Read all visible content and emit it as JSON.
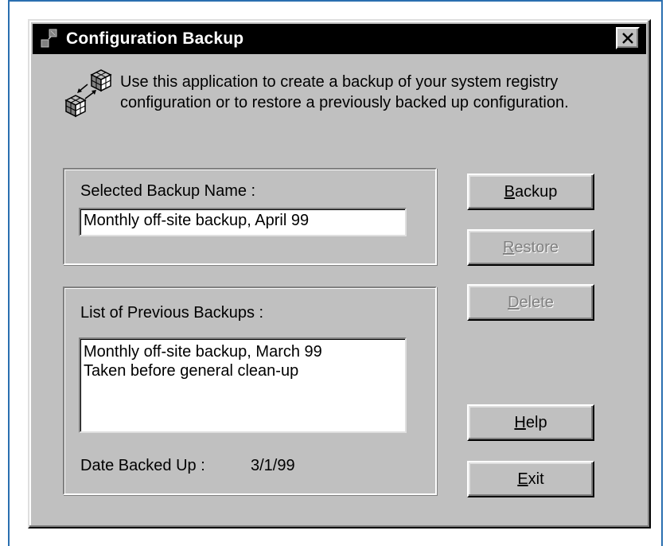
{
  "window": {
    "title": "Configuration Backup",
    "close_symbol": "✕"
  },
  "intro": {
    "line1": "Use this application to create a backup of your system registry",
    "line2": "configuration or to restore a previously backed up configuration.",
    "icon": "backup-cubes-icon"
  },
  "selected_backup": {
    "label": "Selected Backup Name :",
    "value": "Monthly off-site backup, April 99"
  },
  "previous_backups": {
    "label": "List of Previous Backups :",
    "items": [
      "Monthly off-site backup, March 99",
      "Taken before general clean-up"
    ]
  },
  "date_backed_up": {
    "label": "Date Backed Up :",
    "value": "3/1/99"
  },
  "buttons": {
    "backup": {
      "mnemonic": "B",
      "rest": "ackup",
      "enabled": true
    },
    "restore": {
      "mnemonic": "R",
      "rest": "estore",
      "enabled": false
    },
    "delete": {
      "mnemonic": "D",
      "rest": "elete",
      "enabled": false
    },
    "help": {
      "mnemonic": "H",
      "rest": "elp",
      "enabled": true
    },
    "exit": {
      "mnemonic": "E",
      "rest": "xit",
      "enabled": true
    }
  },
  "colors": {
    "face": "#c0c0c0",
    "titlebar": "#000000",
    "page_border": "#2a6fb0"
  }
}
